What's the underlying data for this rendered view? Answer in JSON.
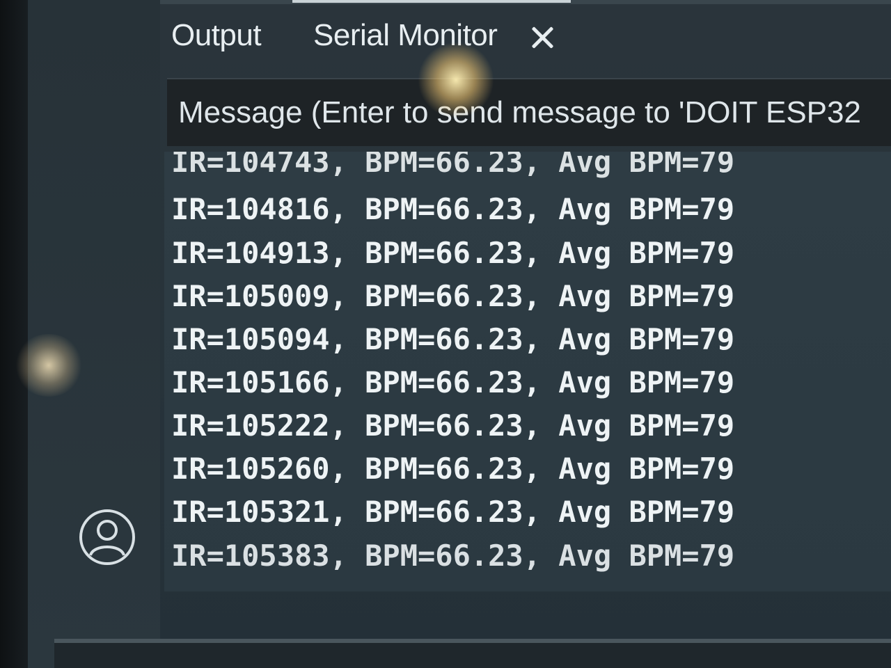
{
  "tabs": {
    "output_label": "Output",
    "serial_monitor_label": "Serial Monitor"
  },
  "message": {
    "placeholder": "Message (Enter to send message to 'DOIT ESP32"
  },
  "serial_output": {
    "lines": [
      "IR=104743, BPM=66.23, Avg BPM=79",
      "IR=104816, BPM=66.23, Avg BPM=79",
      "IR=104913, BPM=66.23, Avg BPM=79",
      "IR=105009, BPM=66.23, Avg BPM=79",
      "IR=105094, BPM=66.23, Avg BPM=79",
      "IR=105166, BPM=66.23, Avg BPM=79",
      "IR=105222, BPM=66.23, Avg BPM=79",
      "IR=105260, BPM=66.23, Avg BPM=79",
      "IR=105321, BPM=66.23, Avg BPM=79",
      "IR=105383, BPM=66.23, Avg BPM=79"
    ]
  },
  "icons": {
    "close": "close-icon",
    "account": "account-icon"
  },
  "colors": {
    "text": "#eef3f5",
    "panel": "#2e3c44",
    "input_bg": "#1e2326"
  }
}
